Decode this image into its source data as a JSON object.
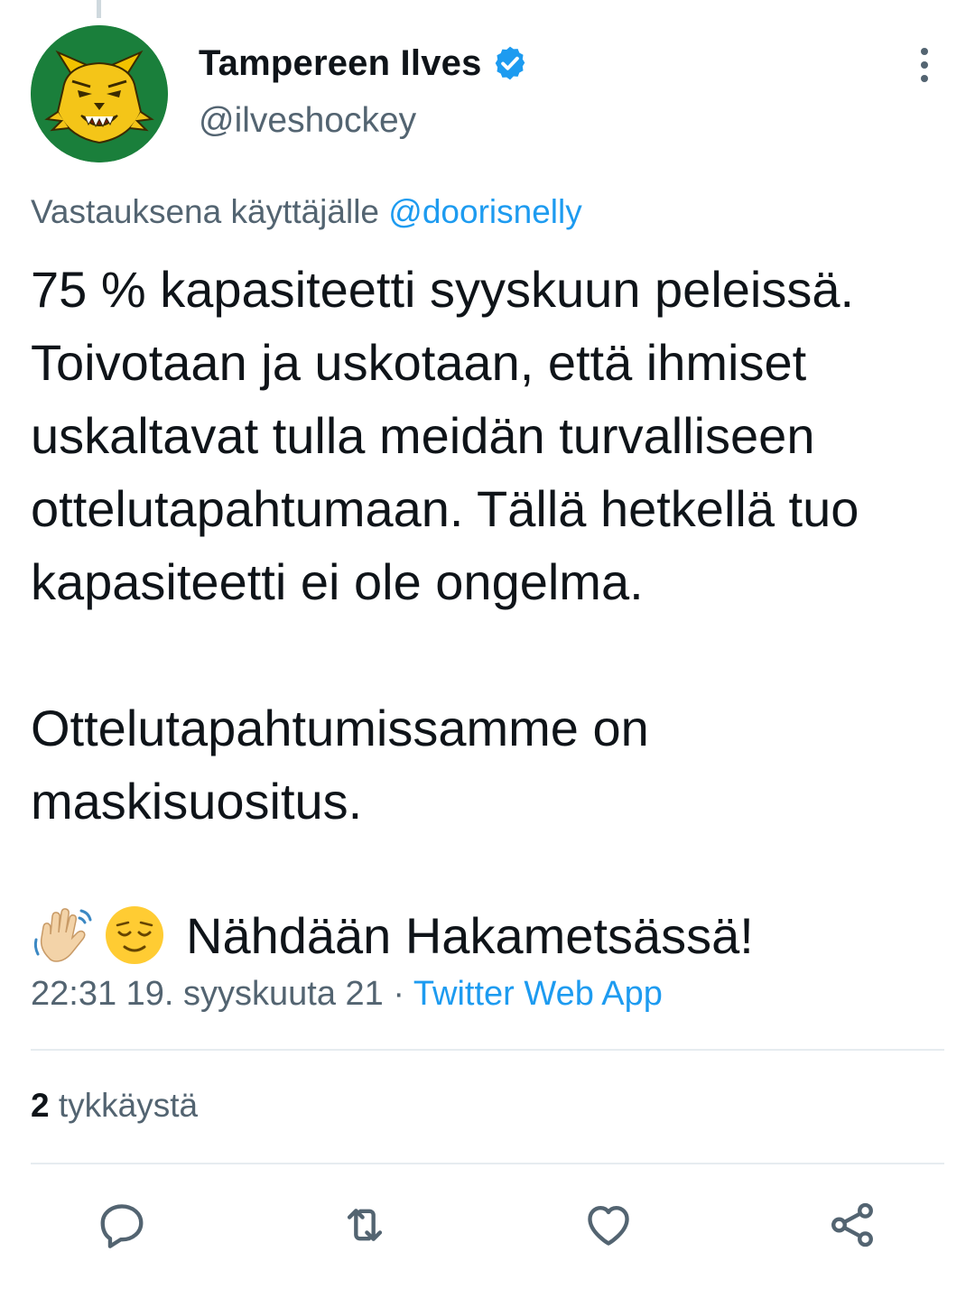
{
  "tweet": {
    "author": {
      "display_name": "Tampereen Ilves",
      "handle": "@ilveshockey",
      "verified": true,
      "avatar_icon": "lynx-logo-icon",
      "avatar_bg": "#1a7f3b"
    },
    "reply_to": {
      "prefix": "Vastauksena käyttäjälle",
      "mention": "@doorisnelly"
    },
    "body": {
      "paragraph_1": "75 % kapasiteetti syyskuun peleissä. Toivotaan ja uskotaan, että ihmiset uskaltavat tulla meidän turvalliseen ottelutapahtumaan. Tällä hetkellä tuo kapasiteetti ei ole ongelma.",
      "paragraph_2": "Ottelutapahtumissamme on maskisuositus.",
      "paragraph_3_emojis": [
        "waving-hand-icon",
        "relieved-face-icon"
      ],
      "paragraph_3_text": "Nähdään Hakametsässä!"
    },
    "timestamp": "22:31 19. syyskuuta 21",
    "separator": "·",
    "source": "Twitter Web App",
    "likes": {
      "count": "2",
      "label": "tykkäystä"
    }
  },
  "actions": {
    "reply": "reply-icon",
    "retweet": "retweet-icon",
    "like": "heart-icon",
    "share": "share-icon"
  },
  "colors": {
    "link": "#1d9bf0",
    "secondary_text": "#536471",
    "primary_text": "#0f1419"
  }
}
